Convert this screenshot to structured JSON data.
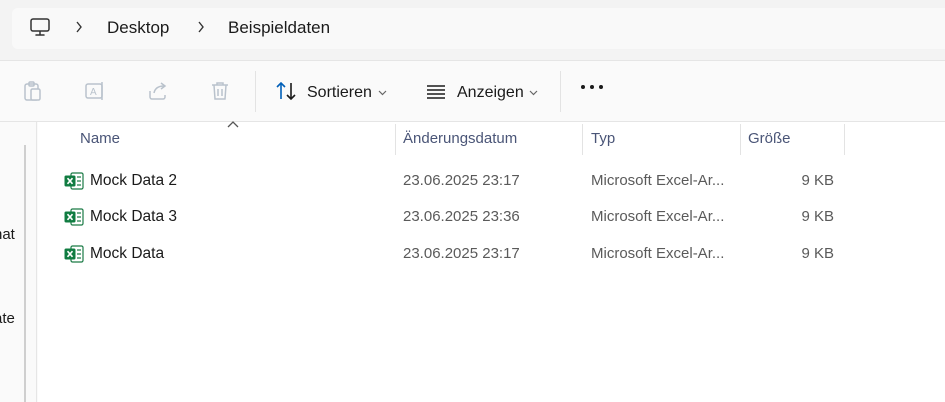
{
  "breadcrumb": {
    "items": [
      "Desktop",
      "Beispieldaten"
    ]
  },
  "toolbar": {
    "sort_label": "Sortieren",
    "view_label": "Anzeigen"
  },
  "nav": {
    "partial_labels": [
      "nat",
      "ate"
    ]
  },
  "columns": {
    "name": "Name",
    "date": "Änderungsdatum",
    "type": "Typ",
    "size": "Größe"
  },
  "files": [
    {
      "name": "Mock Data 2",
      "date": "23.06.2025 23:17",
      "type": "Microsoft Excel-Ar...",
      "size": "9 KB",
      "icon": "excel-file-icon"
    },
    {
      "name": "Mock Data 3",
      "date": "23.06.2025 23:36",
      "type": "Microsoft Excel-Ar...",
      "size": "9 KB",
      "icon": "excel-file-icon"
    },
    {
      "name": "Mock Data",
      "date": "23.06.2025 23:17",
      "type": "Microsoft Excel-Ar...",
      "size": "9 KB",
      "icon": "excel-file-icon"
    }
  ],
  "colors": {
    "excel_green": "#107c41",
    "header_text": "#4a5577",
    "icon_blue": "#005fb8"
  }
}
